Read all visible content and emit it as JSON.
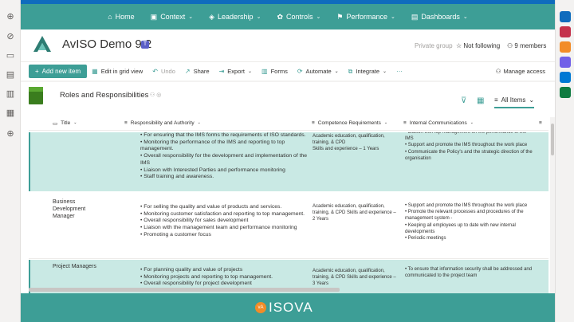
{
  "nav": {
    "items": [
      {
        "label": "Home",
        "icon": "home-icon",
        "glyph": "⌂",
        "has_menu": false
      },
      {
        "label": "Context",
        "icon": "page-icon",
        "glyph": "▣",
        "has_menu": true
      },
      {
        "label": "Leadership",
        "icon": "car-icon",
        "glyph": "◈",
        "has_menu": true
      },
      {
        "label": "Controls",
        "icon": "people-icon",
        "glyph": "✿",
        "has_menu": true
      },
      {
        "label": "Performance",
        "icon": "flag-icon",
        "glyph": "⚑",
        "has_menu": true
      },
      {
        "label": "Dashboards",
        "icon": "dashboard-icon",
        "glyph": "▤",
        "has_menu": true
      }
    ],
    "chevron": "⌄"
  },
  "site": {
    "title": "AvISO Demo 9.2",
    "privacy": "Private group",
    "following": "Not following",
    "members": "9 members",
    "star": "☆",
    "person": "⚇"
  },
  "cmdbar": {
    "add": "Add new item",
    "plus": "+",
    "items": [
      {
        "label": "Edit in grid view",
        "icon": "grid-edit-icon",
        "glyph": "▦",
        "disabled": false,
        "menu": false
      },
      {
        "label": "Undo",
        "icon": "undo-icon",
        "glyph": "↶",
        "disabled": true,
        "menu": false
      },
      {
        "label": "Share",
        "icon": "share-icon",
        "glyph": "↗",
        "disabled": false,
        "menu": false
      },
      {
        "label": "Export",
        "icon": "export-icon",
        "glyph": "⇥",
        "disabled": false,
        "menu": true
      },
      {
        "label": "Forms",
        "icon": "forms-icon",
        "glyph": "▥",
        "disabled": false,
        "menu": false
      },
      {
        "label": "Automate",
        "icon": "automate-icon",
        "glyph": "⟳",
        "disabled": false,
        "menu": true
      },
      {
        "label": "Integrate",
        "icon": "integrate-icon",
        "glyph": "⧉",
        "disabled": false,
        "menu": true
      },
      {
        "label": "",
        "icon": "more-icon",
        "glyph": "···",
        "disabled": false,
        "menu": false
      }
    ],
    "manage": "Manage access",
    "manage_glyph": "⚇",
    "chevron": "⌄"
  },
  "list": {
    "title": "Roles and Responsibilities",
    "title_icons": "⚇ ◎",
    "filter_glyph": "⊽",
    "grid_glyph": "▦",
    "view": "All Items",
    "view_glyph": "≡",
    "view_chevron": "⌄",
    "columns": [
      {
        "label": "Title",
        "glyph": "▭"
      },
      {
        "label": "Responsibility and Authority",
        "glyph": "≡"
      },
      {
        "label": "Competence Requirements",
        "glyph": "≡"
      },
      {
        "label": "Internal Communications",
        "glyph": "≡"
      },
      {
        "label": "",
        "glyph": "≡"
      }
    ],
    "col_chevron": "⌄",
    "rows": [
      {
        "title": "",
        "responsibilities": [
          "For ensuring that the IMS forms the requirements of ISO standards.",
          "Monitoring the performance of the IMS and reporting to top management.",
          "Overall responsibility for the development and implementation of the IMS",
          "Liaison with Interested Parties and performance monitoring",
          "Staff training and awareness."
        ],
        "competence": "Academic education, qualification, training, & CPD\nSkills and experience – 1 Years",
        "communications": [
          "Liaison with top management on the performance of the IMS",
          "Support and promote the IMS throughout the work place",
          "Communicate the Policy's and the strategic direction of the organisation"
        ]
      },
      {
        "title": "Business Development Manager",
        "responsibilities": [
          "For selling the quality and value of products and services.",
          "Monitoring customer satisfaction and reporting to top management.",
          "Overall responsibility for sales development",
          "Liaison with the management team and performance monitoring",
          "Promoting a customer focus"
        ],
        "competence": "Academic education, qualification, training, & CPD Skills and experience – 2 Years",
        "communications": [
          "Support and promote the IMS throughout the work place",
          "Promote the relevant processes and procedures of the management system -",
          "Keeping all employees up to date with new internal developments",
          "Periodic meetings"
        ]
      },
      {
        "title": "Project Managers",
        "responsibilities": [
          "For planning quality and value of projects",
          "Monitoring projects and reporting to top management.",
          "Overall responsibility for project development"
        ],
        "competence": "Academic education, qualification, training, & CPD Skills and experience – 3 Years",
        "communications": [
          "To ensure that information security shall be addressed and communicated to the project team"
        ]
      }
    ]
  },
  "footer": {
    "brand": "ISOVA",
    "badge": "vA"
  },
  "rails": {
    "left": [
      "⊕",
      "⊘",
      "▭",
      "▤",
      "▥",
      "▦",
      "⊕"
    ],
    "right_colors": [
      "#0f6cbd",
      "#c4314b",
      "#f28c28",
      "#7160e8",
      "#0078d4",
      "#107c41"
    ]
  }
}
